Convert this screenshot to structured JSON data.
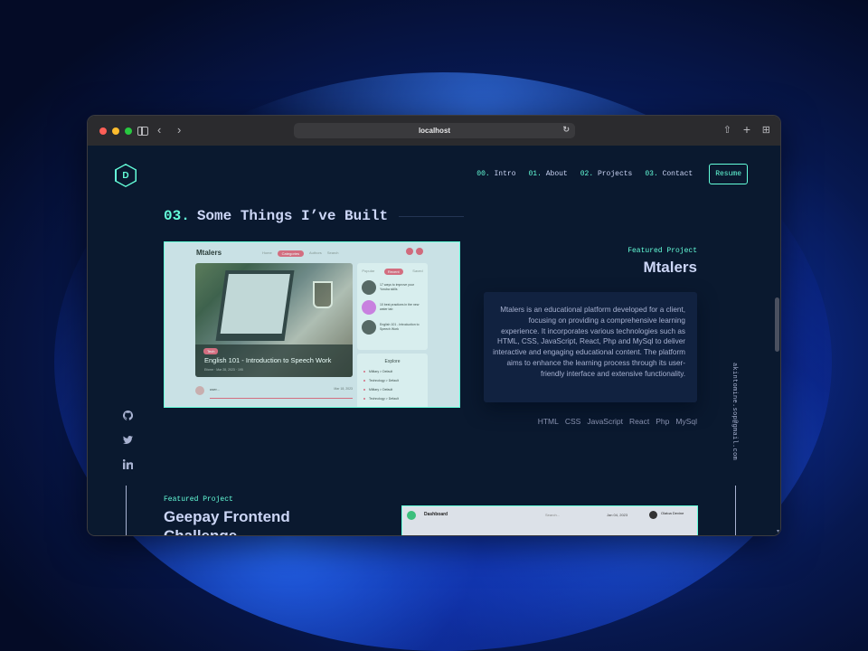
{
  "browser": {
    "url": "localhost"
  },
  "site": {
    "logo_letter": "D",
    "nav": [
      {
        "num": "00.",
        "label": "Intro"
      },
      {
        "num": "01.",
        "label": "About"
      },
      {
        "num": "02.",
        "label": "Projects"
      },
      {
        "num": "03.",
        "label": "Contact"
      }
    ],
    "resume_label": "Resume",
    "email": "akintomine.sop@gmail.com"
  },
  "section": {
    "number": "03.",
    "title": "Some Things I’ve Built"
  },
  "project1": {
    "label": "Featured Project",
    "title": "Mtalers",
    "description": "Mtalers is an educational platform developed for a client, focusing on providing a comprehensive learning experience. It incorporates various technologies such as HTML, CSS, JavaScript, React, Php and MySql to deliver interactive and engaging educational content. The platform aims to enhance the learning process through its user-friendly interface and extensive functionality.",
    "tech": [
      "HTML",
      "CSS",
      "JavaScript",
      "React",
      "Php",
      "MySql"
    ],
    "mockup": {
      "brand": "Mtalers",
      "nav": [
        "Home",
        "Categories",
        "Authors",
        "Search"
      ],
      "card_tag": "Tech",
      "card_title": "English 101 - Introduction to Speech Work",
      "card_meta": "Efome · Mar 28, 2023 · 195",
      "side_tabs": [
        "Popular",
        "Recent",
        "Saved"
      ],
      "side_items": [
        "17 ways to improve your Yoruba skills",
        "10 best practices in the new water tab",
        "English 101 - Introduction to Speech Work"
      ],
      "explore_title": "Explore",
      "explore_items": [
        "Military > Default",
        "Technology > Default",
        "Military > Default",
        "Technology > Default"
      ],
      "comment_name": "user...",
      "comment_date": "Mar 18, 2023"
    }
  },
  "project2": {
    "label": "Featured Project",
    "title": "Geepay Frontend Challenge",
    "mockup": {
      "title": "Dashboard",
      "search": "Search...",
      "date": "Jan 04, 2023",
      "user": "Olatoa Devine"
    }
  },
  "social": [
    "github-icon",
    "twitter-icon",
    "linkedin-icon"
  ]
}
